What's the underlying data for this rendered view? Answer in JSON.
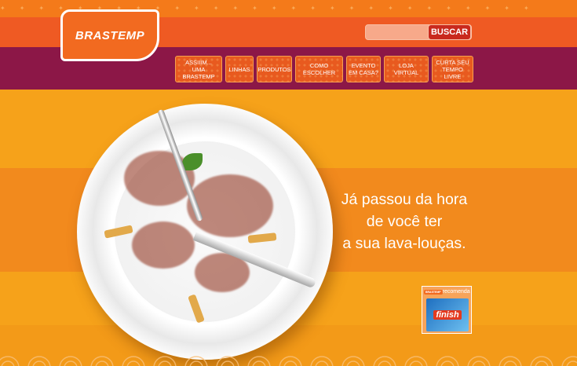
{
  "brand": {
    "logo_text": "BRASTEMP"
  },
  "search": {
    "placeholder": "",
    "button_label": "BUSCAR"
  },
  "nav": {
    "items": [
      {
        "line1": "ASSIIIM...",
        "line2": "UMA BRASTEMP"
      },
      {
        "line1": "LINHAS",
        "line2": ""
      },
      {
        "line1": "PRODUTOS",
        "line2": ""
      },
      {
        "line1": "COMO ESCOLHER",
        "line2": ""
      },
      {
        "line1": "EVENTO",
        "line2": "EM CASA?"
      },
      {
        "line1": "LOJA VIRTUAL",
        "line2": ""
      },
      {
        "line1": "CURTA SEU",
        "line2": "TEMPO LIVRE"
      }
    ]
  },
  "hero": {
    "tagline_lines": [
      "Já passou da hora",
      "de você ter",
      "a sua lava-louças."
    ],
    "image_subject": "plate-clock-with-fork-and-knife"
  },
  "promo": {
    "logo_text": "BRASTEMP",
    "label": "recomenda",
    "product_text": "finish"
  },
  "colors": {
    "orange": "#ef5a23",
    "purple": "#8c1747",
    "yellow_band": "#f6a21a",
    "buscar_red": "#c9291d",
    "white": "#ffffff"
  }
}
